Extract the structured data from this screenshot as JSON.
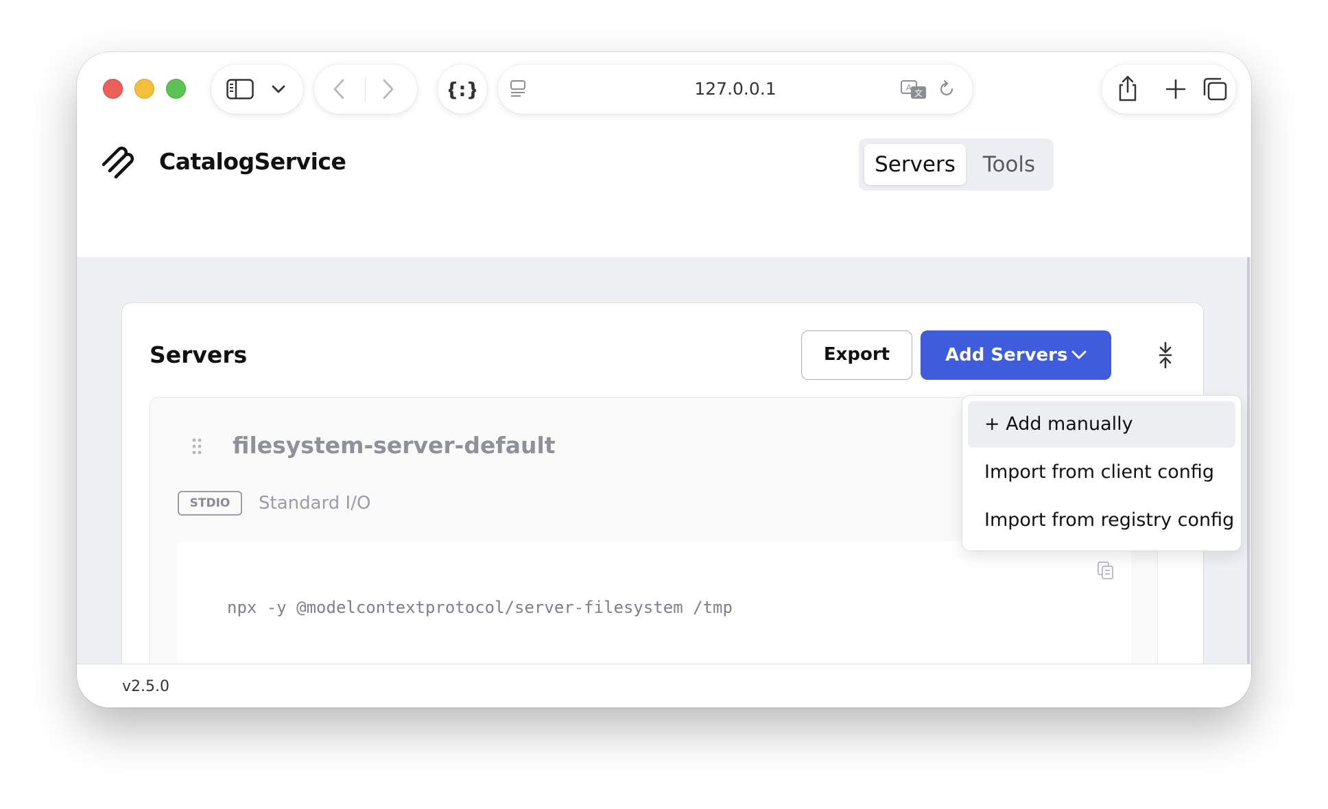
{
  "browser": {
    "url": "127.0.0.1",
    "icons": [
      "sidebar-icon",
      "chevron-down-icon",
      "back-icon",
      "forward-icon",
      "extension-icon",
      "reader-icon",
      "translate-icon",
      "reload-icon",
      "share-icon",
      "new-tab-icon",
      "tabs-overview-icon"
    ]
  },
  "app": {
    "title": "CatalogService",
    "nav": {
      "servers": "Servers",
      "tools": "Tools",
      "active": "Servers"
    }
  },
  "panel": {
    "title": "Servers",
    "export_label": "Export",
    "add_label": "Add Servers"
  },
  "server": {
    "name": "filesystem-server-default",
    "badge": "STDIO",
    "transport": "Standard I/O",
    "command": "npx -y @modelcontextprotocol/server-filesystem /tmp"
  },
  "menu": {
    "items": [
      "+ Add manually",
      "Import from client config",
      "Import from registry config"
    ],
    "highlighted": "+ Add manually"
  },
  "footer": {
    "version": "v2.5.0"
  },
  "colors": {
    "accent": "#3e5cdc",
    "background": "#eef0f4",
    "close": "#ec5f5a",
    "minimize": "#f4bf3b",
    "zoom": "#5dc355"
  }
}
